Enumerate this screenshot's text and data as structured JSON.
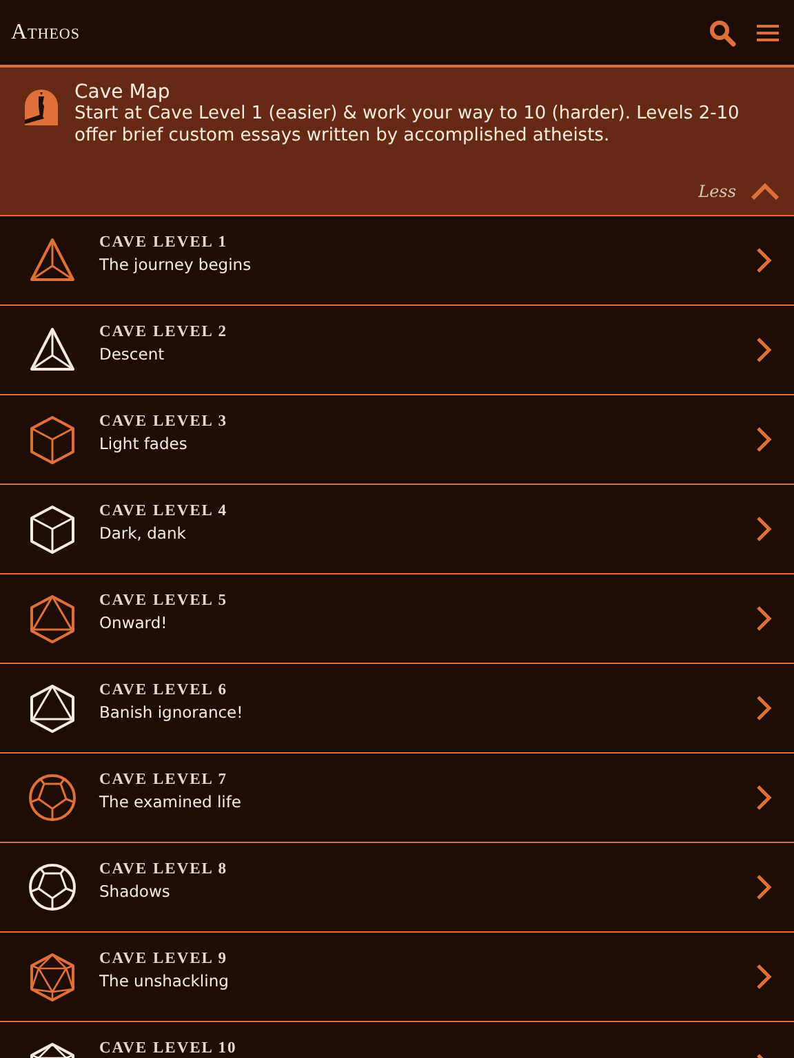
{
  "app_bar": {
    "title": "Atheos"
  },
  "banner": {
    "title": "Cave Map",
    "text": "Start at Cave Level 1 (easier) & work your way to 10 (harder). Levels 2-10 offer brief custom essays written by accomplished atheists.",
    "toggle_label": "Less",
    "expanded": true
  },
  "levels": [
    {
      "title": "CAVE LEVEL 1",
      "subtitle": "The journey begins",
      "kind": "tetrahedron",
      "color": "#e0703a"
    },
    {
      "title": "CAVE LEVEL 2",
      "subtitle": "Descent",
      "kind": "tetrahedron",
      "color": "#f5ebe0"
    },
    {
      "title": "CAVE LEVEL 3",
      "subtitle": "Light fades",
      "kind": "cube",
      "color": "#e0703a"
    },
    {
      "title": "CAVE LEVEL 4",
      "subtitle": "Dark, dank",
      "kind": "cube",
      "color": "#f5ebe0"
    },
    {
      "title": "CAVE LEVEL 5",
      "subtitle": "Onward!",
      "kind": "octahedron",
      "color": "#e0703a"
    },
    {
      "title": "CAVE LEVEL 6",
      "subtitle": "Banish ignorance!",
      "kind": "octahedron",
      "color": "#f5ebe0"
    },
    {
      "title": "CAVE LEVEL 7",
      "subtitle": "The examined life",
      "kind": "dodecahedron",
      "color": "#e0703a"
    },
    {
      "title": "CAVE LEVEL 8",
      "subtitle": "Shadows",
      "kind": "dodecahedron",
      "color": "#f5ebe0"
    },
    {
      "title": "CAVE LEVEL 9",
      "subtitle": "The unshackling",
      "kind": "icosahedron",
      "color": "#e0703a"
    },
    {
      "title": "CAVE LEVEL 10",
      "kind": "icosahedron",
      "color": "#f5ebe0"
    }
  ]
}
